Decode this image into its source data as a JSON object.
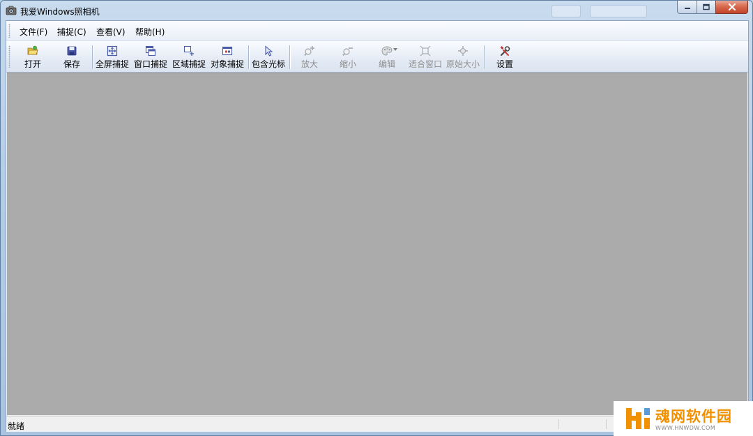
{
  "window": {
    "title": "我爱Windows照相机"
  },
  "menu": [
    {
      "label": "文件(F)"
    },
    {
      "label": "捕捉(C)"
    },
    {
      "label": "查看(V)"
    },
    {
      "label": "帮助(H)"
    }
  ],
  "toolbar": [
    {
      "label": "打开",
      "icon": "open-folder-icon",
      "enabled": true
    },
    {
      "label": "保存",
      "icon": "save-disk-icon",
      "enabled": true
    },
    {
      "label": "全屏捕捉",
      "icon": "fullscreen-capture-icon",
      "enabled": true
    },
    {
      "label": "窗口捕捉",
      "icon": "window-capture-icon",
      "enabled": true
    },
    {
      "label": "区域捕捉",
      "icon": "region-capture-icon",
      "enabled": true
    },
    {
      "label": "对象捕捉",
      "icon": "object-capture-icon",
      "enabled": true
    },
    {
      "label": "包含光标",
      "icon": "cursor-icon",
      "enabled": true
    },
    {
      "label": "放大",
      "icon": "zoom-in-icon",
      "enabled": false
    },
    {
      "label": "缩小",
      "icon": "zoom-out-icon",
      "enabled": false
    },
    {
      "label": "编辑",
      "icon": "edit-palette-icon",
      "enabled": false
    },
    {
      "label": "适合窗口",
      "icon": "fit-window-icon",
      "enabled": false
    },
    {
      "label": "原始大小",
      "icon": "original-size-icon",
      "enabled": false
    },
    {
      "label": "设置",
      "icon": "settings-tools-icon",
      "enabled": true
    }
  ],
  "status": {
    "text": "就绪"
  },
  "watermark": {
    "title": "魂网软件园",
    "url": "WWW.HNWDW.COM"
  },
  "colors": {
    "canvas": "#ababab",
    "accent": "#3a62b0",
    "watermark": "#f29100"
  }
}
